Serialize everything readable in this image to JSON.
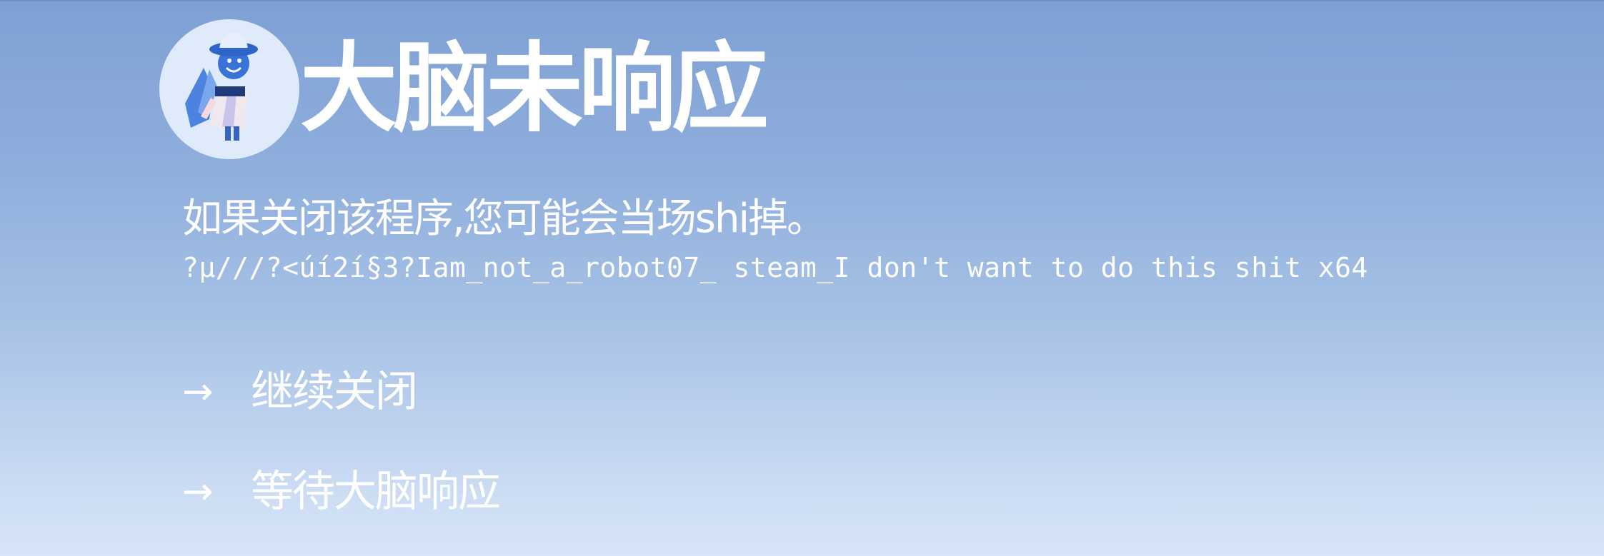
{
  "dialog": {
    "title": "大脑未响应",
    "warning": "如果关闭该程序,您可能会当场shi掉。",
    "process": "?µ///?<úí2í§3?Iam_not_a_robot07_ steam_I don't want to do this shit x64",
    "options": [
      {
        "arrow": "→",
        "label": "继续关闭"
      },
      {
        "arrow": "→",
        "label": "等待大脑响应"
      }
    ]
  },
  "colors": {
    "background_top": "#7ea0d3",
    "background_bottom": "#d7e5f8",
    "avatar_circle": "#dfeafb",
    "text": "#ffffff"
  },
  "icons": {
    "avatar": "character-with-bucket-hat"
  }
}
